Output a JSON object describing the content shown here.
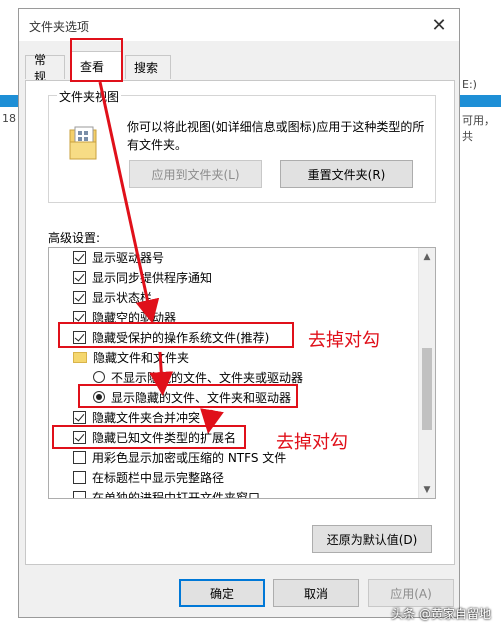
{
  "background": {
    "left_number": "18",
    "right_top": "E:)",
    "right_text": "可用，共"
  },
  "dialog": {
    "title": "文件夹选项",
    "tabs": [
      "常规",
      "查看",
      "搜索"
    ],
    "active_tab": "查看"
  },
  "folder_views": {
    "legend": "文件夹视图",
    "description": "你可以将此视图(如详细信息或图标)应用于这种类型的所有文件夹。",
    "apply_button": "应用到文件夹(L)",
    "reset_button": "重置文件夹(R)"
  },
  "advanced": {
    "label": "高级设置:",
    "items": [
      {
        "type": "checkbox",
        "checked": true,
        "label": "显示驱动器号"
      },
      {
        "type": "checkbox",
        "checked": true,
        "label": "显示同步提供程序通知"
      },
      {
        "type": "checkbox",
        "checked": true,
        "label": "显示状态栏"
      },
      {
        "type": "checkbox",
        "checked": true,
        "label": "隐藏空的驱动器"
      },
      {
        "type": "checkbox",
        "checked": true,
        "label": "隐藏受保护的操作系统文件(推荐)"
      },
      {
        "type": "folder",
        "label": "隐藏文件和文件夹"
      },
      {
        "type": "radio",
        "checked": false,
        "label": "不显示隐藏的文件、文件夹或驱动器"
      },
      {
        "type": "radio",
        "checked": true,
        "label": "显示隐藏的文件、文件夹和驱动器"
      },
      {
        "type": "checkbox",
        "checked": true,
        "label": "隐藏文件夹合并冲突"
      },
      {
        "type": "checkbox",
        "checked": true,
        "label": "隐藏已知文件类型的扩展名"
      },
      {
        "type": "checkbox",
        "checked": false,
        "label": "用彩色显示加密或压缩的 NTFS 文件"
      },
      {
        "type": "checkbox",
        "checked": false,
        "label": "在标题栏中显示完整路径"
      },
      {
        "type": "checkbox",
        "checked": false,
        "label": "在单独的进程中打开文件夹窗口"
      }
    ],
    "restore_button": "还原为默认值(D)"
  },
  "footer": {
    "ok": "确定",
    "cancel": "取消",
    "apply": "应用(A)"
  },
  "annotations": {
    "note1": "去掉对勾",
    "note2": "去掉对勾",
    "color": "#e0101a"
  },
  "watermark": "头条 @黄家自留地"
}
